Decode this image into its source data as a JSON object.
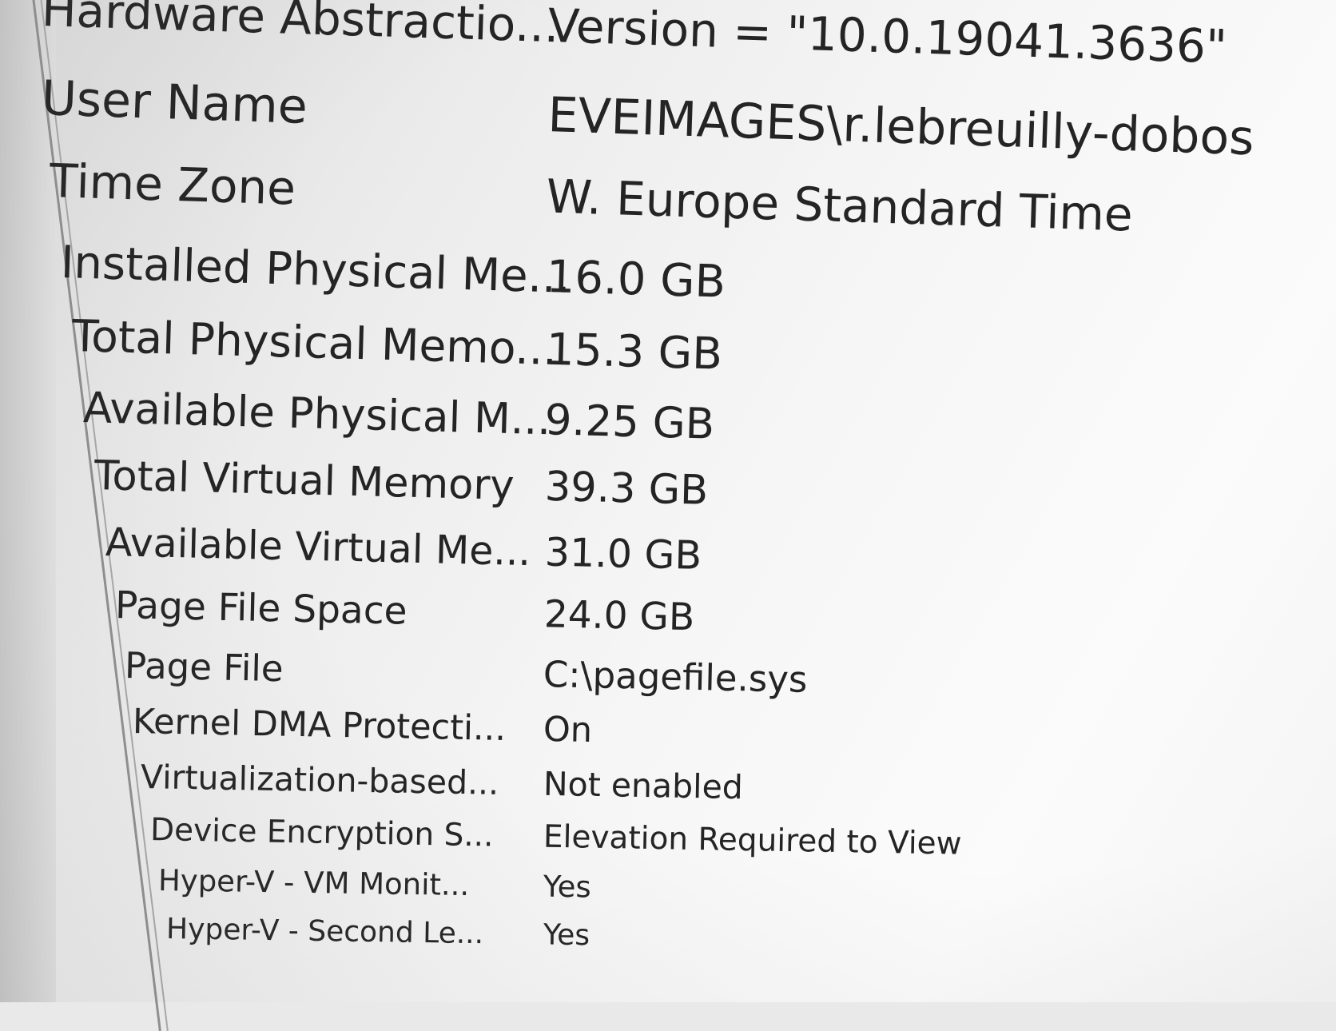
{
  "system_summary": {
    "rows": [
      {
        "item": "Hardware Abstractio...",
        "value": "Version = \"10.0.19041.3636\""
      },
      {
        "item": "User Name",
        "value": "EVEIMAGES\\r.lebreuilly-dobos"
      },
      {
        "item": "Time Zone",
        "value": "W. Europe Standard Time"
      },
      {
        "item": "Installed Physical Me...",
        "value": "16.0 GB"
      },
      {
        "item": "Total Physical Memo...",
        "value": "15.3 GB"
      },
      {
        "item": "Available Physical M...",
        "value": "9.25 GB"
      },
      {
        "item": "Total Virtual Memory",
        "value": "39.3 GB"
      },
      {
        "item": "Available Virtual Me...",
        "value": "31.0 GB"
      },
      {
        "item": "Page File Space",
        "value": "24.0 GB"
      },
      {
        "item": "Page File",
        "value": "C:\\pagefile.sys"
      },
      {
        "item": "Kernel DMA Protecti...",
        "value": "On"
      },
      {
        "item": "Virtualization-based...",
        "value": "Not enabled"
      },
      {
        "item": "Device Encryption S...",
        "value": "Elevation Required to View"
      },
      {
        "item": "Hyper-V - VM Monit...",
        "value": "Yes"
      },
      {
        "item": "Hyper-V - Second Le...",
        "value": "Yes"
      }
    ]
  }
}
